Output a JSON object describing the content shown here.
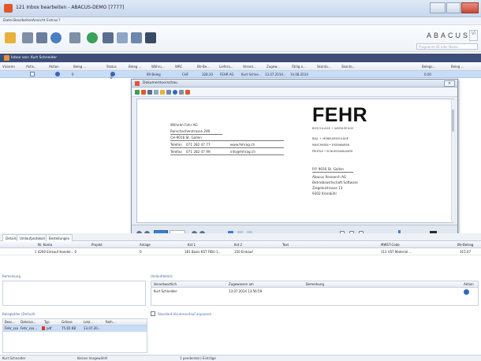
{
  "window": {
    "title": "121 Inbox bearbeiten - ABACUS-DEMO [7777]"
  },
  "menu": [
    "Datei",
    "Bearbeiten",
    "Ansicht",
    "Extras",
    "?"
  ],
  "brand": {
    "name": "ABACUS",
    "box": "Vi"
  },
  "search": {
    "placeholder": "Programm-ID oder Name"
  },
  "inbox": {
    "title": "Inbox von: Kurt Schneider"
  },
  "grid": {
    "columns": [
      "Visieren",
      "Aktiv...",
      "Aktion",
      "Beleg ...",
      "Status",
      "Beleg ...",
      "Währu...",
      "WRC",
      "Btr-Be...",
      "Liefera...",
      "Verant...",
      "Zugew...",
      "Fällig a...",
      "Skonto...",
      "Skonto...",
      "Belegs...",
      "Beleg ..."
    ],
    "row": [
      "0",
      "0",
      "89 Beleg",
      "CHF",
      "328.20",
      "FEHR AG",
      "Kurt Schne...",
      "13.07.2014...",
      "14.08.2014",
      "0.00"
    ]
  },
  "preview": {
    "title": "Dokumentvorschau",
    "sender": {
      "line1": "Wilhelm Fehr AG",
      "line2": "Rorschacherstrasse 290",
      "line3": "CH-9016 St. Gallen",
      "phone_label": "Telefon",
      "phone": "071 282 47 77",
      "web": "www.fehrag.ch",
      "fax_label": "Telefax",
      "fax": "071 282 47 99",
      "email": "info@fehrag.ch"
    },
    "logo": {
      "name": "FEHR",
      "tagline": "BESCHLÄGE • WERKZEUGE"
    },
    "services": [
      "BAU- + MÖBELBESCHLÄGE",
      "MASCHINEN • EISENWAREN",
      "PROFILE • SCHLIESSANLAGEN"
    ],
    "recipient": {
      "pp": "P.P. 9016 St. Gallen",
      "line1": "Abacus Research AG",
      "line2": "Betriebswirtschaft Software",
      "line3": "Ziegeleistrasse 13",
      "line4": "9302 Kronbühl"
    },
    "page_field": ""
  },
  "tabs": [
    "Details",
    "Umlaufprotokoll",
    "Bestellungen"
  ],
  "details": {
    "columns": [
      "Nr. Konto",
      "Projekt",
      "Anlage",
      "Kst 1",
      "Kst 2",
      "Text",
      "MWST-Code",
      "Btr-Betrag"
    ],
    "row": [
      "1 4200 Einkauf Handel... 0",
      "0",
      "181 Basis-KST FIBU 1...",
      "150 Einkauf",
      "111 VST Material ...",
      "315.07"
    ]
  },
  "remark": {
    "label": "Bemerkung"
  },
  "circulation": {
    "label": "Umlaufdetails",
    "columns": [
      "Verantwortlich",
      "Zugewiesen am",
      "Bemerkung",
      "Aktion"
    ],
    "row": [
      "Kurt Schneider",
      "13.07.2014 13:56:59"
    ]
  },
  "attachments": {
    "label": "Belegbilder (Default)",
    "columns": [
      "Besc...",
      "Dateina...",
      "Typ",
      "Grösse",
      "Letz...",
      "Reih..."
    ],
    "row": [
      "Fehr_ssx",
      "Fehr_ssx...",
      "pdf",
      "75.65 KB",
      "13.07.20..."
    ]
  },
  "standard_flow": {
    "label": "Standard-Visumsverlauf anpassen"
  },
  "status": [
    "Kurt Schneider",
    "Keinen Vorgewählt!",
    "1 pendente(r) Einträge"
  ],
  "colors": {
    "accent": "#3d4f78",
    "selected_row": "#c9dcf7",
    "logo_accent": "#e2562a"
  }
}
